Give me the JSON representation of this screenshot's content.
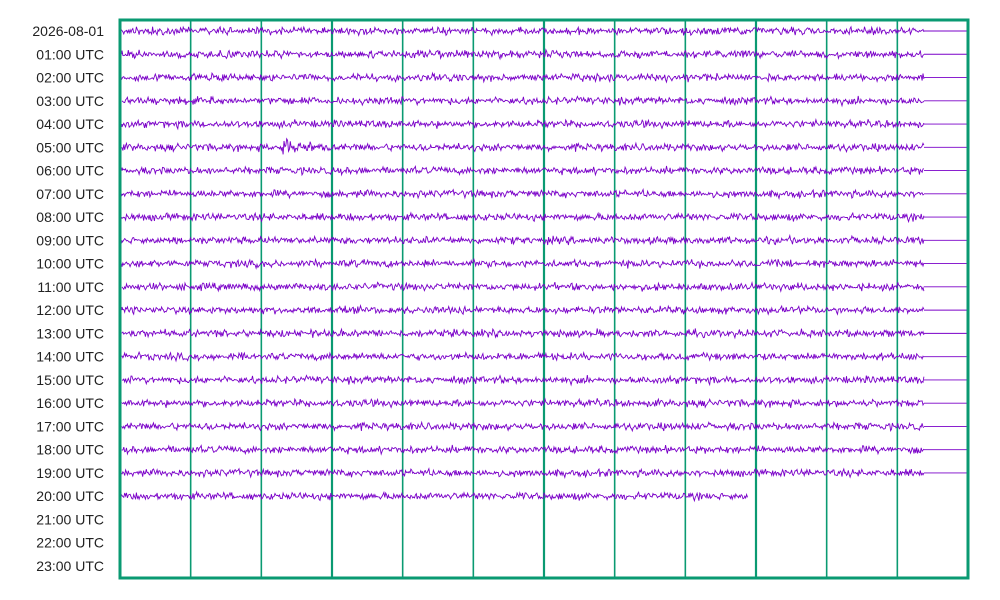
{
  "chart_data": {
    "type": "line",
    "description_kind": "helicorder",
    "start_label": "2026-08-01",
    "row_labels": [
      "2026-08-01",
      "01:00 UTC",
      "02:00 UTC",
      "03:00 UTC",
      "04:00 UTC",
      "05:00 UTC",
      "06:00 UTC",
      "07:00 UTC",
      "08:00 UTC",
      "09:00 UTC",
      "10:00 UTC",
      "11:00 UTC",
      "12:00 UTC",
      "13:00 UTC",
      "14:00 UTC",
      "15:00 UTC",
      "16:00 UTC",
      "17:00 UTC",
      "18:00 UTC",
      "19:00 UTC",
      "20:00 UTC",
      "21:00 UTC",
      "22:00 UTC",
      "23:00 UTC"
    ],
    "rows_total": 24,
    "rows_recorded": 21,
    "minutes_per_row": 60,
    "vertical_gridlines": 12,
    "traces": [
      {
        "row": 0,
        "fraction_recorded": 0.948
      },
      {
        "row": 1,
        "fraction_recorded": 0.948
      },
      {
        "row": 2,
        "fraction_recorded": 0.948
      },
      {
        "row": 3,
        "fraction_recorded": 0.948
      },
      {
        "row": 4,
        "fraction_recorded": 0.948
      },
      {
        "row": 5,
        "fraction_recorded": 0.948,
        "event": {
          "fraction": 0.195,
          "amplitude": 2.6
        }
      },
      {
        "row": 6,
        "fraction_recorded": 0.948
      },
      {
        "row": 7,
        "fraction_recorded": 0.948
      },
      {
        "row": 8,
        "fraction_recorded": 0.948
      },
      {
        "row": 9,
        "fraction_recorded": 0.948
      },
      {
        "row": 10,
        "fraction_recorded": 0.948
      },
      {
        "row": 11,
        "fraction_recorded": 0.948
      },
      {
        "row": 12,
        "fraction_recorded": 0.948
      },
      {
        "row": 13,
        "fraction_recorded": 0.948
      },
      {
        "row": 14,
        "fraction_recorded": 0.948
      },
      {
        "row": 15,
        "fraction_recorded": 0.948
      },
      {
        "row": 16,
        "fraction_recorded": 0.948
      },
      {
        "row": 17,
        "fraction_recorded": 0.948
      },
      {
        "row": 18,
        "fraction_recorded": 0.948
      },
      {
        "row": 19,
        "fraction_recorded": 0.948
      },
      {
        "row": 20,
        "fraction_recorded": 0.74
      }
    ],
    "colors": {
      "trace": "#7a00c8",
      "frame": "#0a9a72",
      "grid": "#0a9a72",
      "label": "#222222"
    },
    "grid": true,
    "title": "",
    "xlabel": "",
    "ylabel": ""
  }
}
